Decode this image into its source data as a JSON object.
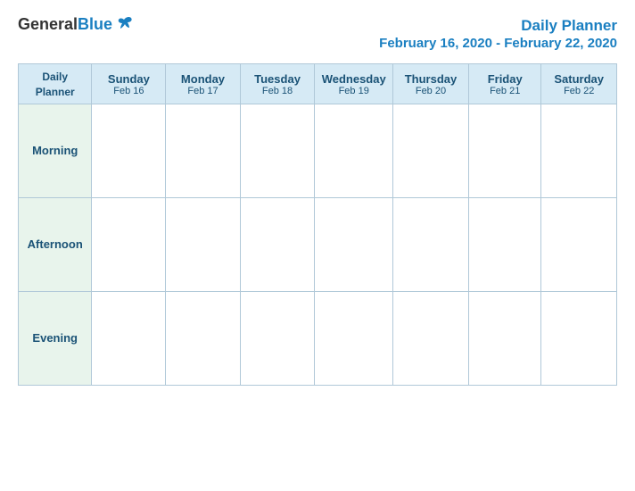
{
  "header": {
    "logo_general": "General",
    "logo_blue": "Blue",
    "title": "Daily Planner",
    "date_range": "February 16, 2020 - February 22, 2020"
  },
  "table": {
    "first_col_header": [
      "Daily",
      "Planner"
    ],
    "columns": [
      {
        "day": "Sunday",
        "date": "Feb 16"
      },
      {
        "day": "Monday",
        "date": "Feb 17"
      },
      {
        "day": "Tuesday",
        "date": "Feb 18"
      },
      {
        "day": "Wednesday",
        "date": "Feb 19"
      },
      {
        "day": "Thursday",
        "date": "Feb 20"
      },
      {
        "day": "Friday",
        "date": "Feb 21"
      },
      {
        "day": "Saturday",
        "date": "Feb 22"
      }
    ],
    "rows": [
      {
        "label": "Morning"
      },
      {
        "label": "Afternoon"
      },
      {
        "label": "Evening"
      }
    ]
  }
}
